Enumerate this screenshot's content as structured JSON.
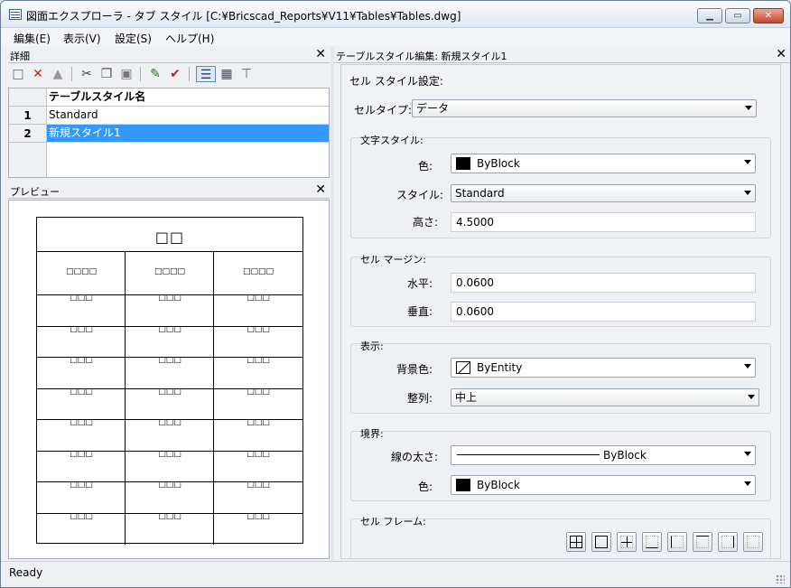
{
  "window": {
    "title": "図面エクスプローラ - タブ スタイル [C:¥Bricscad_Reports¥V11¥Tables¥Tables.dwg]",
    "min_glyph": "▁",
    "max_glyph": "▭",
    "close_glyph": "✕"
  },
  "menu": [
    "編集(E)",
    "表示(V)",
    "設定(S)",
    "ヘルプ(H)"
  ],
  "details_pane": {
    "title": "詳細",
    "close_glyph": "✕",
    "toolbar": [
      {
        "icon": "new-icon",
        "glyph": "□"
      },
      {
        "icon": "delete-icon",
        "glyph": "✕"
      },
      {
        "icon": "purge-icon",
        "glyph": "▲"
      },
      {
        "icon": "cut-icon",
        "glyph": "✂"
      },
      {
        "icon": "copy-icon",
        "glyph": "❐"
      },
      {
        "icon": "paste-icon",
        "glyph": "▣"
      },
      {
        "icon": "edit-icon",
        "glyph": "✎"
      },
      {
        "icon": "set-current-icon",
        "glyph": "✔"
      },
      {
        "icon": "details-view-icon",
        "glyph": "☰"
      },
      {
        "icon": "icons-view-icon",
        "glyph": "▦"
      },
      {
        "icon": "tree-view-icon",
        "glyph": "⊤"
      }
    ],
    "column_header": "テーブルスタイル名",
    "rows": [
      {
        "num": "1",
        "name": "Standard",
        "selected": false
      },
      {
        "num": "2",
        "name": "新規スタイル1",
        "selected": true
      }
    ]
  },
  "preview_pane": {
    "title": "プレビュー",
    "close_glyph": "✕",
    "table_title": "□□",
    "header_cell": "□□□□",
    "data_cell": "□□□",
    "data_rows": 8
  },
  "editor_pane": {
    "title": "テーブルスタイル編集: 新規スタイル1",
    "close_glyph": "✕",
    "cell_style_label": "セル スタイル設定:",
    "cell_type_label": "セルタイプ:",
    "cell_type_value": "データ",
    "text_style": {
      "label": "文字スタイル:",
      "color_label": "色:",
      "color_value": "ByBlock",
      "style_label": "スタイル:",
      "style_value": "Standard",
      "height_label": "高さ:",
      "height_value": "4.5000"
    },
    "cell_margin": {
      "label": "セル マージン:",
      "horizontal_label": "水平:",
      "horizontal_value": "0.0600",
      "vertical_label": "垂直:",
      "vertical_value": "0.0600"
    },
    "display": {
      "label": "表示:",
      "bg_label": "背景色:",
      "bg_value": "ByEntity",
      "align_label": "整列:",
      "align_value": "中上"
    },
    "border": {
      "label": "境界:",
      "lineweight_label": "線の太さ:",
      "lineweight_value": "ByBlock",
      "color_label": "色:",
      "color_value": "ByBlock"
    },
    "cell_frame": {
      "label": "セル フレーム:",
      "buttons": [
        "all-borders-icon",
        "outside-border-icon",
        "inside-border-icon",
        "bottom-border-icon",
        "left-border-icon",
        "top-border-icon",
        "right-border-icon",
        "no-border-icon"
      ]
    }
  },
  "status": {
    "text": "Ready"
  },
  "colors": {
    "selection": "#3399ff",
    "close_button": "#c8422b",
    "delete_icon": "#d0201a"
  }
}
